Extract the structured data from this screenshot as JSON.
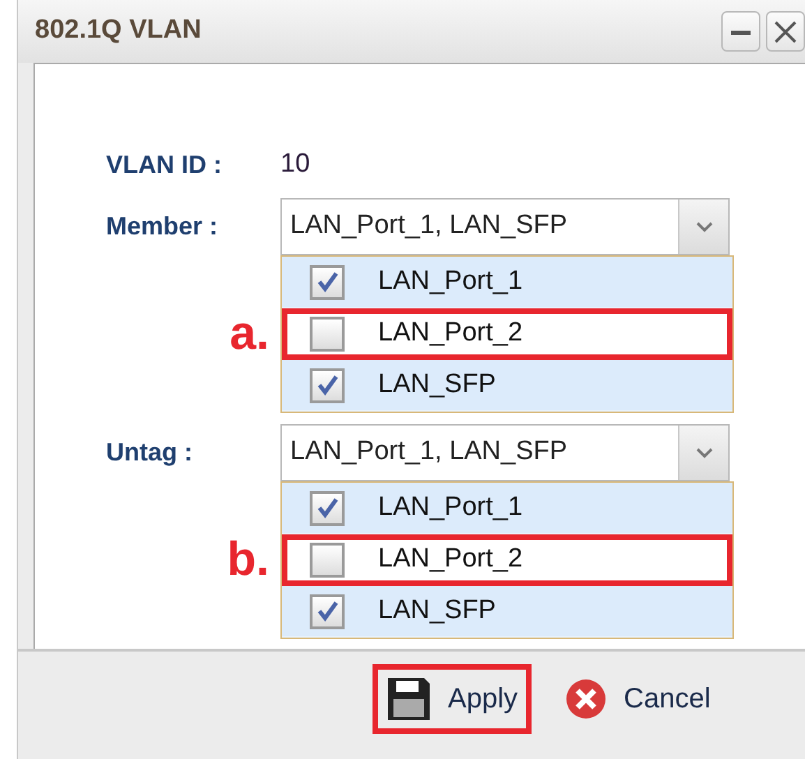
{
  "window": {
    "title": "802.1Q VLAN"
  },
  "vlan_id": {
    "label": "VLAN ID :",
    "value": "10"
  },
  "fields": [
    {
      "label": "Member :",
      "value": "LAN_Port_1, LAN_SFP",
      "marker": "a.",
      "options": [
        {
          "label": "LAN_Port_1",
          "checked": true,
          "highlighted": false
        },
        {
          "label": "LAN_Port_2",
          "checked": false,
          "highlighted": true
        },
        {
          "label": "LAN_SFP",
          "checked": true,
          "highlighted": false
        }
      ]
    },
    {
      "label": "Untag :",
      "value": "LAN_Port_1, LAN_SFP",
      "marker": "b.",
      "options": [
        {
          "label": "LAN_Port_1",
          "checked": true,
          "highlighted": false
        },
        {
          "label": "LAN_Port_2",
          "checked": false,
          "highlighted": true
        },
        {
          "label": "LAN_SFP",
          "checked": true,
          "highlighted": false
        }
      ]
    }
  ],
  "buttons": [
    {
      "kind": "save",
      "label": "Apply",
      "highlighted": true
    },
    {
      "kind": "cancel",
      "label": "Cancel",
      "highlighted": false
    }
  ]
}
